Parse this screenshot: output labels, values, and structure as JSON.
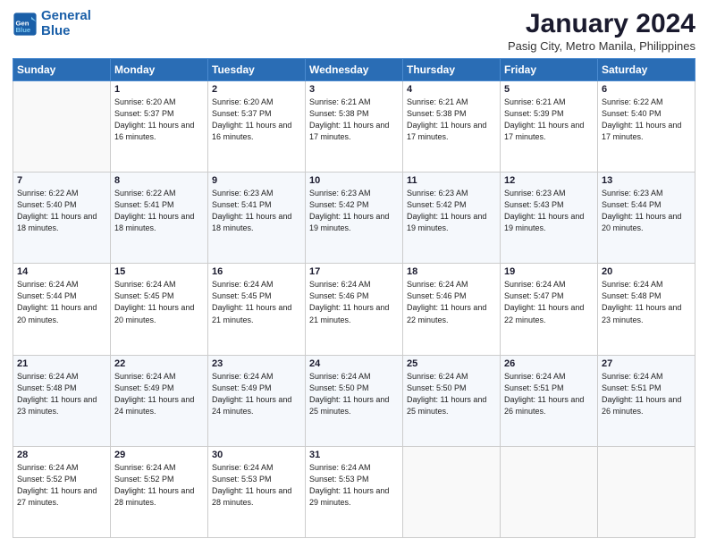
{
  "header": {
    "logo_line1": "General",
    "logo_line2": "Blue",
    "title": "January 2024",
    "subtitle": "Pasig City, Metro Manila, Philippines"
  },
  "days_of_week": [
    "Sunday",
    "Monday",
    "Tuesday",
    "Wednesday",
    "Thursday",
    "Friday",
    "Saturday"
  ],
  "weeks": [
    [
      {
        "day": "",
        "info": ""
      },
      {
        "day": "1",
        "info": "Sunrise: 6:20 AM\nSunset: 5:37 PM\nDaylight: 11 hours and 16 minutes."
      },
      {
        "day": "2",
        "info": "Sunrise: 6:20 AM\nSunset: 5:37 PM\nDaylight: 11 hours and 16 minutes."
      },
      {
        "day": "3",
        "info": "Sunrise: 6:21 AM\nSunset: 5:38 PM\nDaylight: 11 hours and 17 minutes."
      },
      {
        "day": "4",
        "info": "Sunrise: 6:21 AM\nSunset: 5:38 PM\nDaylight: 11 hours and 17 minutes."
      },
      {
        "day": "5",
        "info": "Sunrise: 6:21 AM\nSunset: 5:39 PM\nDaylight: 11 hours and 17 minutes."
      },
      {
        "day": "6",
        "info": "Sunrise: 6:22 AM\nSunset: 5:40 PM\nDaylight: 11 hours and 17 minutes."
      }
    ],
    [
      {
        "day": "7",
        "info": "Sunrise: 6:22 AM\nSunset: 5:40 PM\nDaylight: 11 hours and 18 minutes."
      },
      {
        "day": "8",
        "info": "Sunrise: 6:22 AM\nSunset: 5:41 PM\nDaylight: 11 hours and 18 minutes."
      },
      {
        "day": "9",
        "info": "Sunrise: 6:23 AM\nSunset: 5:41 PM\nDaylight: 11 hours and 18 minutes."
      },
      {
        "day": "10",
        "info": "Sunrise: 6:23 AM\nSunset: 5:42 PM\nDaylight: 11 hours and 19 minutes."
      },
      {
        "day": "11",
        "info": "Sunrise: 6:23 AM\nSunset: 5:42 PM\nDaylight: 11 hours and 19 minutes."
      },
      {
        "day": "12",
        "info": "Sunrise: 6:23 AM\nSunset: 5:43 PM\nDaylight: 11 hours and 19 minutes."
      },
      {
        "day": "13",
        "info": "Sunrise: 6:23 AM\nSunset: 5:44 PM\nDaylight: 11 hours and 20 minutes."
      }
    ],
    [
      {
        "day": "14",
        "info": "Sunrise: 6:24 AM\nSunset: 5:44 PM\nDaylight: 11 hours and 20 minutes."
      },
      {
        "day": "15",
        "info": "Sunrise: 6:24 AM\nSunset: 5:45 PM\nDaylight: 11 hours and 20 minutes."
      },
      {
        "day": "16",
        "info": "Sunrise: 6:24 AM\nSunset: 5:45 PM\nDaylight: 11 hours and 21 minutes."
      },
      {
        "day": "17",
        "info": "Sunrise: 6:24 AM\nSunset: 5:46 PM\nDaylight: 11 hours and 21 minutes."
      },
      {
        "day": "18",
        "info": "Sunrise: 6:24 AM\nSunset: 5:46 PM\nDaylight: 11 hours and 22 minutes."
      },
      {
        "day": "19",
        "info": "Sunrise: 6:24 AM\nSunset: 5:47 PM\nDaylight: 11 hours and 22 minutes."
      },
      {
        "day": "20",
        "info": "Sunrise: 6:24 AM\nSunset: 5:48 PM\nDaylight: 11 hours and 23 minutes."
      }
    ],
    [
      {
        "day": "21",
        "info": "Sunrise: 6:24 AM\nSunset: 5:48 PM\nDaylight: 11 hours and 23 minutes."
      },
      {
        "day": "22",
        "info": "Sunrise: 6:24 AM\nSunset: 5:49 PM\nDaylight: 11 hours and 24 minutes."
      },
      {
        "day": "23",
        "info": "Sunrise: 6:24 AM\nSunset: 5:49 PM\nDaylight: 11 hours and 24 minutes."
      },
      {
        "day": "24",
        "info": "Sunrise: 6:24 AM\nSunset: 5:50 PM\nDaylight: 11 hours and 25 minutes."
      },
      {
        "day": "25",
        "info": "Sunrise: 6:24 AM\nSunset: 5:50 PM\nDaylight: 11 hours and 25 minutes."
      },
      {
        "day": "26",
        "info": "Sunrise: 6:24 AM\nSunset: 5:51 PM\nDaylight: 11 hours and 26 minutes."
      },
      {
        "day": "27",
        "info": "Sunrise: 6:24 AM\nSunset: 5:51 PM\nDaylight: 11 hours and 26 minutes."
      }
    ],
    [
      {
        "day": "28",
        "info": "Sunrise: 6:24 AM\nSunset: 5:52 PM\nDaylight: 11 hours and 27 minutes."
      },
      {
        "day": "29",
        "info": "Sunrise: 6:24 AM\nSunset: 5:52 PM\nDaylight: 11 hours and 28 minutes."
      },
      {
        "day": "30",
        "info": "Sunrise: 6:24 AM\nSunset: 5:53 PM\nDaylight: 11 hours and 28 minutes."
      },
      {
        "day": "31",
        "info": "Sunrise: 6:24 AM\nSunset: 5:53 PM\nDaylight: 11 hours and 29 minutes."
      },
      {
        "day": "",
        "info": ""
      },
      {
        "day": "",
        "info": ""
      },
      {
        "day": "",
        "info": ""
      }
    ]
  ]
}
